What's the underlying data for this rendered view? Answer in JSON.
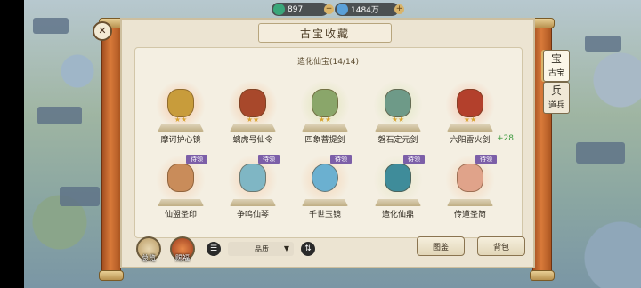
{
  "currency": {
    "jade": {
      "value": "897",
      "icon": "jade-coin-icon",
      "color": "#3aa77a"
    },
    "gems": {
      "value": "1484万",
      "icon": "gem-icon",
      "color": "#5aa0d8"
    }
  },
  "panel": {
    "title": "古宝收藏",
    "section": "造化仙宝(14/14)"
  },
  "items": [
    {
      "name": "摩诃护心镜",
      "stars": "★★",
      "tag": "",
      "glow": "#f7c6a3",
      "art": "#c89c3b"
    },
    {
      "name": "螭虎号仙令",
      "stars": "★★",
      "tag": "",
      "glow": "#f5c9a5",
      "art": "#a8482b"
    },
    {
      "name": "四象菩提剑",
      "stars": "★★",
      "tag": "",
      "glow": "#dfe3b8",
      "art": "#8aa66a"
    },
    {
      "name": "磐石定元剑",
      "stars": "★★",
      "tag": "",
      "glow": "#dde6c0",
      "art": "#6e9a88"
    },
    {
      "name": "六阳雷火剑",
      "stars": "★★",
      "tag": "",
      "glow": "#f6c3aa",
      "art": "#b3402c"
    },
    {
      "name": "仙盟圣印",
      "stars": "",
      "tag": "待领",
      "glow": "#f6d2b5",
      "art": "#c98c5a"
    },
    {
      "name": "争鸣仙琴",
      "stars": "",
      "tag": "待领",
      "glow": "#f6d2b5",
      "art": "#7fb6c4"
    },
    {
      "name": "千世玉镜",
      "stars": "",
      "tag": "待领",
      "glow": "#f4d4b5",
      "art": "#6bb0d0"
    },
    {
      "name": "造化仙鼎",
      "stars": "",
      "tag": "待领",
      "glow": "#e6e6c8",
      "art": "#3f8c9a"
    },
    {
      "name": "传道圣简",
      "stars": "",
      "tag": "待领",
      "glow": "#f6d2b5",
      "art": "#e0a38a"
    }
  ],
  "extra_count": "+28",
  "side_tabs": [
    {
      "label": "古宝",
      "glyph": "宝",
      "icon": "treasure-icon"
    },
    {
      "label": "道兵",
      "glyph": "兵",
      "icon": "weapon-icon"
    }
  ],
  "bottom": {
    "summary_label": "总览",
    "bless_label": "赐福",
    "filter_label": "品质",
    "atlas_button": "图鉴",
    "bag_button": "背包"
  }
}
